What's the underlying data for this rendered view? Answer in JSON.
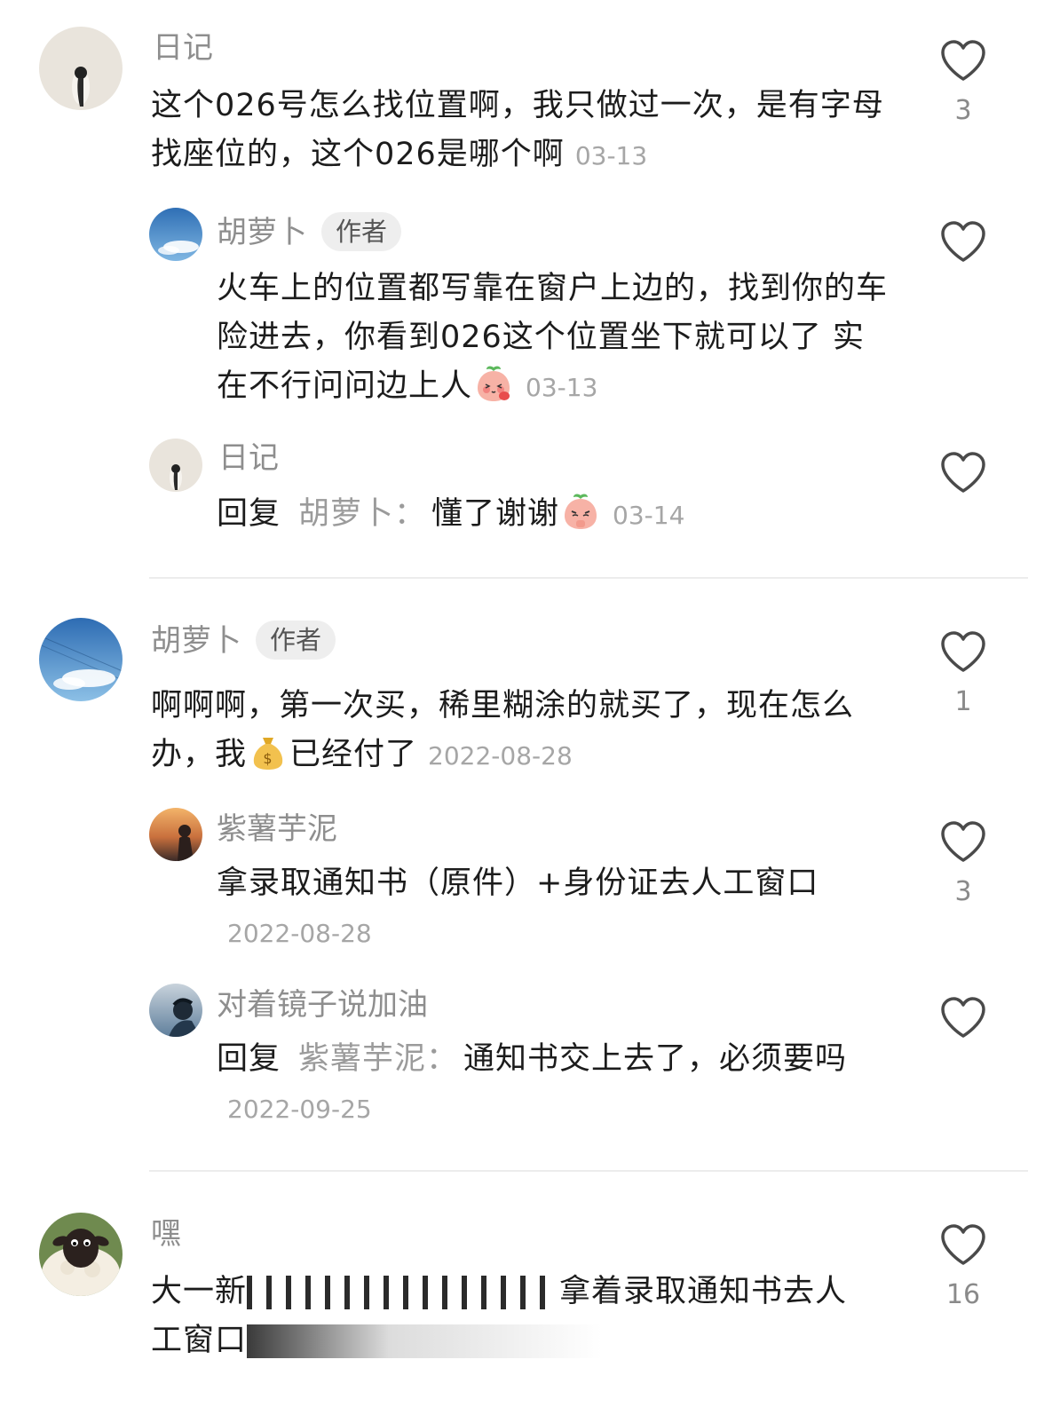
{
  "comments": [
    {
      "user": "日记",
      "text": "这个026号怎么找位置啊，我只做过一次，是有字母找座位的，这个026是哪个啊",
      "time": "03-13",
      "likes": "3",
      "replies": [
        {
          "user": "胡萝卜",
          "badge": "作者",
          "text": "火车上的位置都写靠在窗户上边的，找到你的车险进去，你看到026这个位置坐下就可以了 实在不行问问边上人",
          "emoji": "blushing-peach-emoji",
          "time": "03-13"
        },
        {
          "user": "日记",
          "reply_prefix": "回复",
          "reply_to": "胡萝卜：",
          "text": "懂了谢谢",
          "emoji": "thankful-peach-emoji",
          "time": "03-14"
        }
      ]
    },
    {
      "user": "胡萝卜",
      "badge": "作者",
      "text_before": "啊啊啊，第一次买，稀里糊涂的就买了，现在怎么办，我",
      "emoji": "money-bag-emoji",
      "text_after": "已经付了",
      "time": "2022-08-28",
      "likes": "1",
      "replies": [
        {
          "user": "紫薯芋泥",
          "text": "拿录取通知书（原件）+身份证去人工窗口",
          "time": "2022-08-28",
          "likes": "3"
        },
        {
          "user": "对着镜子说加油",
          "reply_prefix": "回复",
          "reply_to": "紫薯芋泥：",
          "text": "通知书交上去了，必须要吗",
          "time": "2022-09-25"
        }
      ]
    },
    {
      "user": "嘿",
      "text_line1_start": "大一新",
      "text_line1_end": "拿着录取通知书去人",
      "text_line2_start": "工窗口",
      "likes": "16"
    }
  ]
}
